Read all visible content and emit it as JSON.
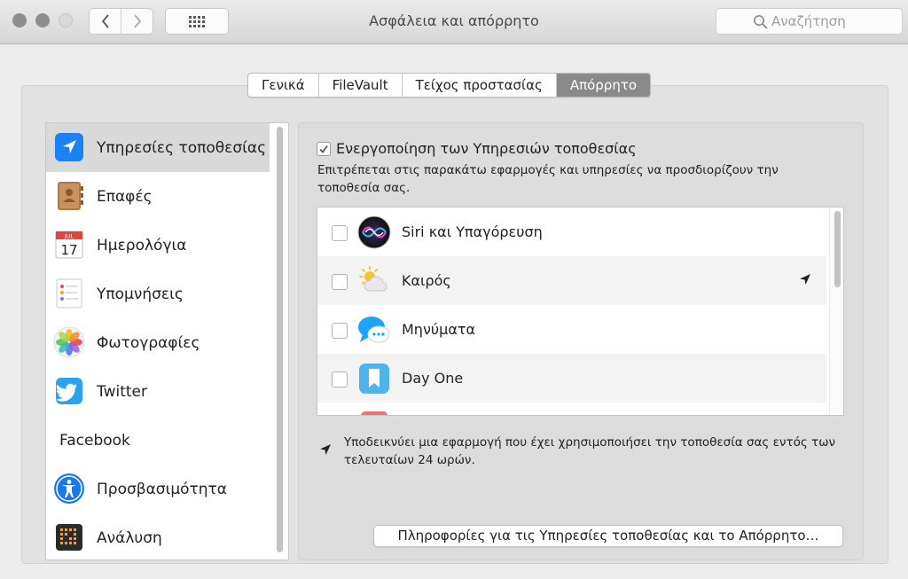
{
  "window": {
    "title": "Ασφάλεια και απόρρητο",
    "search_placeholder": "Αναζήτηση"
  },
  "tabs": [
    {
      "label": "Γενικά",
      "active": false
    },
    {
      "label": "FileVault",
      "active": false
    },
    {
      "label": "Τείχος προστασίας",
      "active": false
    },
    {
      "label": "Απόρρητο",
      "active": true
    }
  ],
  "sidebar": {
    "items": [
      {
        "label": "Υπηρεσίες τοποθεσίας",
        "icon": "location-arrow-icon",
        "selected": true
      },
      {
        "label": "Επαφές",
        "icon": "contacts-book-icon"
      },
      {
        "label": "Ημερολόγια",
        "icon": "calendar-icon",
        "calendar_month": "JUL",
        "calendar_day": "17"
      },
      {
        "label": "Υπομνήσεις",
        "icon": "reminders-icon"
      },
      {
        "label": "Φωτογραφίες",
        "icon": "photos-icon"
      },
      {
        "label": "Twitter",
        "icon": "twitter-icon"
      },
      {
        "label": "Facebook",
        "icon": ""
      },
      {
        "label": "Προσβασιμότητα",
        "icon": "accessibility-icon"
      },
      {
        "label": "Ανάλυση",
        "icon": "analytics-icon"
      }
    ]
  },
  "location": {
    "enable_label": "Ενεργοποίηση των Υπηρεσιών τοποθεσίας",
    "enabled": true,
    "description": "Επιτρέπεται στις παρακάτω εφαρμογές και υπηρεσίες να προσδιορίζουν την τοποθεσία σας.",
    "apps": [
      {
        "name": "Siri και Υπαγόρευση",
        "icon": "siri-icon",
        "checked": false,
        "recent_use": false
      },
      {
        "name": "Καιρός",
        "icon": "weather-icon",
        "checked": false,
        "recent_use": true
      },
      {
        "name": "Μηνύματα",
        "icon": "messages-icon",
        "checked": false,
        "recent_use": false
      },
      {
        "name": "Day One",
        "icon": "day-one-icon",
        "checked": false,
        "recent_use": false
      }
    ],
    "note": "Υποδεικνύει μια εφαρμογή που έχει χρησιμοποιήσει την τοποθεσία σας εντός των τελευταίων 24 ωρών.",
    "info_button": "Πληροφορίες για τις Υπηρεσίες τοποθεσίας και το Απόρρητο…"
  },
  "colors": {
    "accent_blue": "#1a82f4",
    "active_tab": "#8a8a8a",
    "selected_row": "#d9d9d9"
  }
}
